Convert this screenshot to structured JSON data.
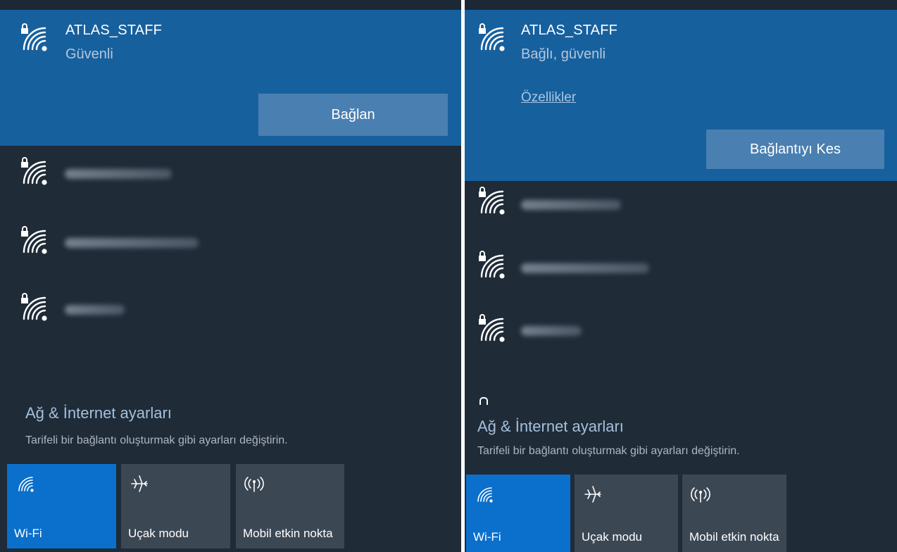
{
  "left_panel": {
    "selected_network": {
      "name": "ATLAS_STAFF",
      "status": "Güvenli",
      "action_label": "Bağlan",
      "icon": "wifi-secured-icon"
    },
    "other_networks": [
      {
        "icon": "wifi-secured-icon"
      },
      {
        "icon": "wifi-secured-icon"
      },
      {
        "icon": "wifi-secured-icon"
      }
    ],
    "settings": {
      "title": "Ağ & İnternet ayarları",
      "description": "Tarifeli bir bağlantı oluşturmak gibi ayarları değiştirin."
    },
    "quick_actions": [
      {
        "label": "Wi-Fi",
        "icon": "wifi-icon",
        "active": true
      },
      {
        "label": "Uçak modu",
        "icon": "airplane-icon",
        "active": false
      },
      {
        "label": "Mobil etkin nokta",
        "icon": "hotspot-icon",
        "active": false
      }
    ]
  },
  "right_panel": {
    "selected_network": {
      "name": "ATLAS_STAFF",
      "status": "Bağlı, güvenli",
      "properties_label": "Özellikler",
      "action_label": "Bağlantıyı Kes",
      "icon": "wifi-secured-icon"
    },
    "other_networks": [
      {
        "icon": "wifi-secured-icon"
      },
      {
        "icon": "wifi-secured-icon"
      },
      {
        "icon": "wifi-secured-icon"
      }
    ],
    "settings": {
      "title": "Ağ & İnternet ayarları",
      "description": "Tarifeli bir bağlantı oluşturmak gibi ayarları değiştirin."
    },
    "quick_actions": [
      {
        "label": "Wi-Fi",
        "icon": "wifi-icon",
        "active": true
      },
      {
        "label": "Uçak modu",
        "icon": "airplane-icon",
        "active": false
      },
      {
        "label": "Mobil etkin nokta",
        "icon": "hotspot-icon",
        "active": false
      }
    ]
  },
  "colors": {
    "background": "#1f2b37",
    "selected_bg": "#17609e",
    "button_bg": "#4a7fb1",
    "tile_active": "#0b6fcc",
    "tile_inactive": "#3c4754",
    "settings_link": "#a4c0dc"
  }
}
